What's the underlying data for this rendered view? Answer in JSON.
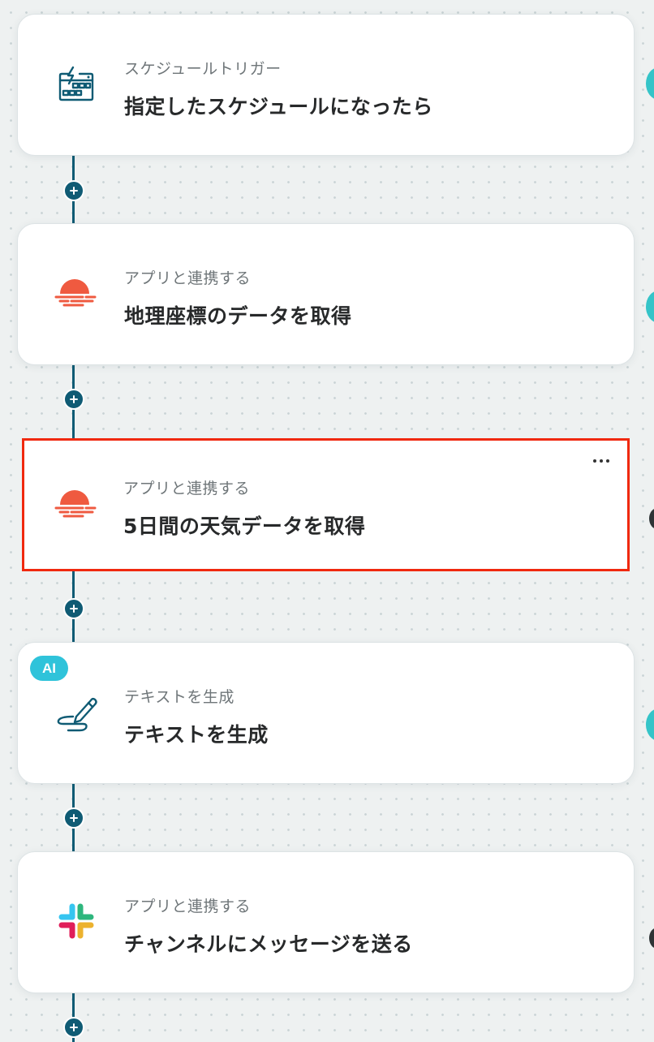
{
  "workflow": {
    "steps": [
      {
        "subtitle": "スケジュールトリガー",
        "title": "指定したスケジュールになったら",
        "icon": "calendar-schedule-icon",
        "accent_color": "#0f5b74"
      },
      {
        "subtitle": "アプリと連携する",
        "title": "地理座標のデータを取得",
        "icon": "weather-app-icon",
        "accent_color": "#ef5a40"
      },
      {
        "subtitle": "アプリと連携する",
        "title": "5日間の天気データを取得",
        "icon": "weather-app-icon",
        "accent_color": "#ef5a40",
        "selected": true,
        "highlight_color": "#f0290f"
      },
      {
        "subtitle": "テキストを生成",
        "title": "テキストを生成",
        "icon": "pen-text-icon",
        "accent_color": "#0f5b74",
        "badge": "AI"
      },
      {
        "subtitle": "アプリと連携する",
        "title": "チャンネルにメッセージを送る",
        "icon": "slack-icon"
      }
    ],
    "add_step_icon": "plus-icon",
    "more_menu_icon": "ellipsis-icon"
  },
  "colors": {
    "connector": "#0f5b74",
    "ai_badge": "#2fc3da",
    "side_bubble_teal": "#35c4c8"
  }
}
